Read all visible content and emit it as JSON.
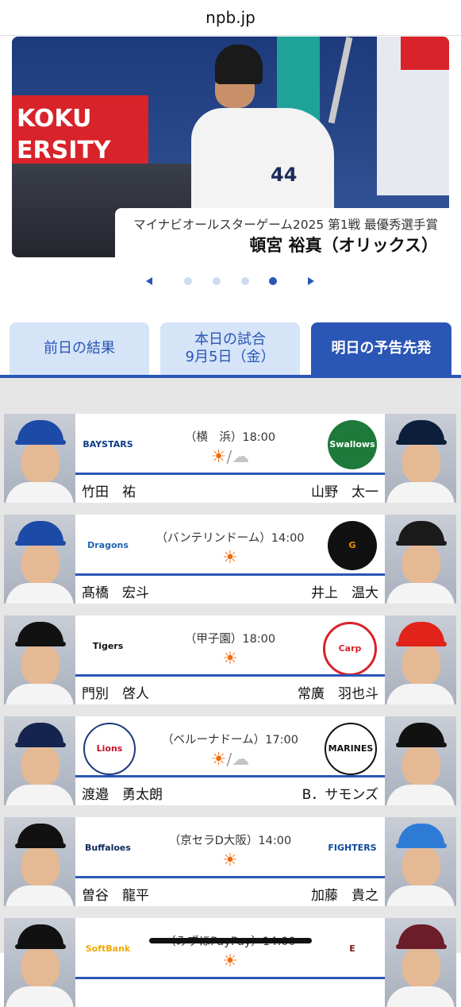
{
  "browser": {
    "url": "npb.jp"
  },
  "hero": {
    "caption_sub": "マイナビオールスターゲーム2025 第1戦 最優秀選手賞",
    "caption_main": "頓宮 裕真（オリックス）",
    "slides": 4,
    "active_slide": 4
  },
  "tabs": [
    {
      "label": "前日の結果"
    },
    {
      "label": "本日の試合",
      "sub": "9月5日（金）"
    },
    {
      "label": "明日の予告先発",
      "active": true
    }
  ],
  "games": [
    {
      "venue_time": "（横　浜）18:00",
      "weather": [
        "sun",
        "cloud"
      ],
      "home": {
        "team": "DeNA",
        "logo": "BAYSTARS",
        "pitcher": "竹田　祐"
      },
      "away": {
        "team": "Swallows",
        "logo": "Swallows",
        "pitcher": "山野　太一"
      }
    },
    {
      "venue_time": "（バンテリンドーム）14:00",
      "weather": [
        "sun"
      ],
      "home": {
        "team": "Dragons",
        "logo": "Dragons",
        "pitcher": "髙橋　宏斗"
      },
      "away": {
        "team": "Giants",
        "logo": "G",
        "pitcher": "井上　温大"
      }
    },
    {
      "venue_time": "（甲子園）18:00",
      "weather": [
        "sun"
      ],
      "home": {
        "team": "Tigers",
        "logo": "Tigers",
        "pitcher": "門別　啓人"
      },
      "away": {
        "team": "Carp",
        "logo": "Carp",
        "pitcher": "常廣　羽也斗"
      }
    },
    {
      "venue_time": "（ベルーナドーム）17:00",
      "weather": [
        "sun",
        "cloud"
      ],
      "home": {
        "team": "Lions",
        "logo": "Lions",
        "pitcher": "渡邉　勇太朗"
      },
      "away": {
        "team": "Marines",
        "logo": "MARINES",
        "pitcher": "B．サモンズ"
      }
    },
    {
      "venue_time": "（京セラD大阪）14:00",
      "weather": [
        "sun"
      ],
      "home": {
        "team": "Buffaloes",
        "logo": "Buffaloes",
        "pitcher": "曽谷　龍平"
      },
      "away": {
        "team": "Fighters",
        "logo": "FIGHTERS",
        "pitcher": "加藤　貴之"
      }
    },
    {
      "venue_time": "（みずほPayPay）14:00",
      "weather": [
        "sun"
      ],
      "home": {
        "team": "Hawks",
        "logo": "SoftBank",
        "pitcher": ""
      },
      "away": {
        "team": "Eagles",
        "logo": "E",
        "pitcher": ""
      }
    }
  ],
  "colors": {
    "accent": "#2a56b5",
    "tab_inactive_bg": "#d6e4f7",
    "sun": "#f26b0a"
  }
}
